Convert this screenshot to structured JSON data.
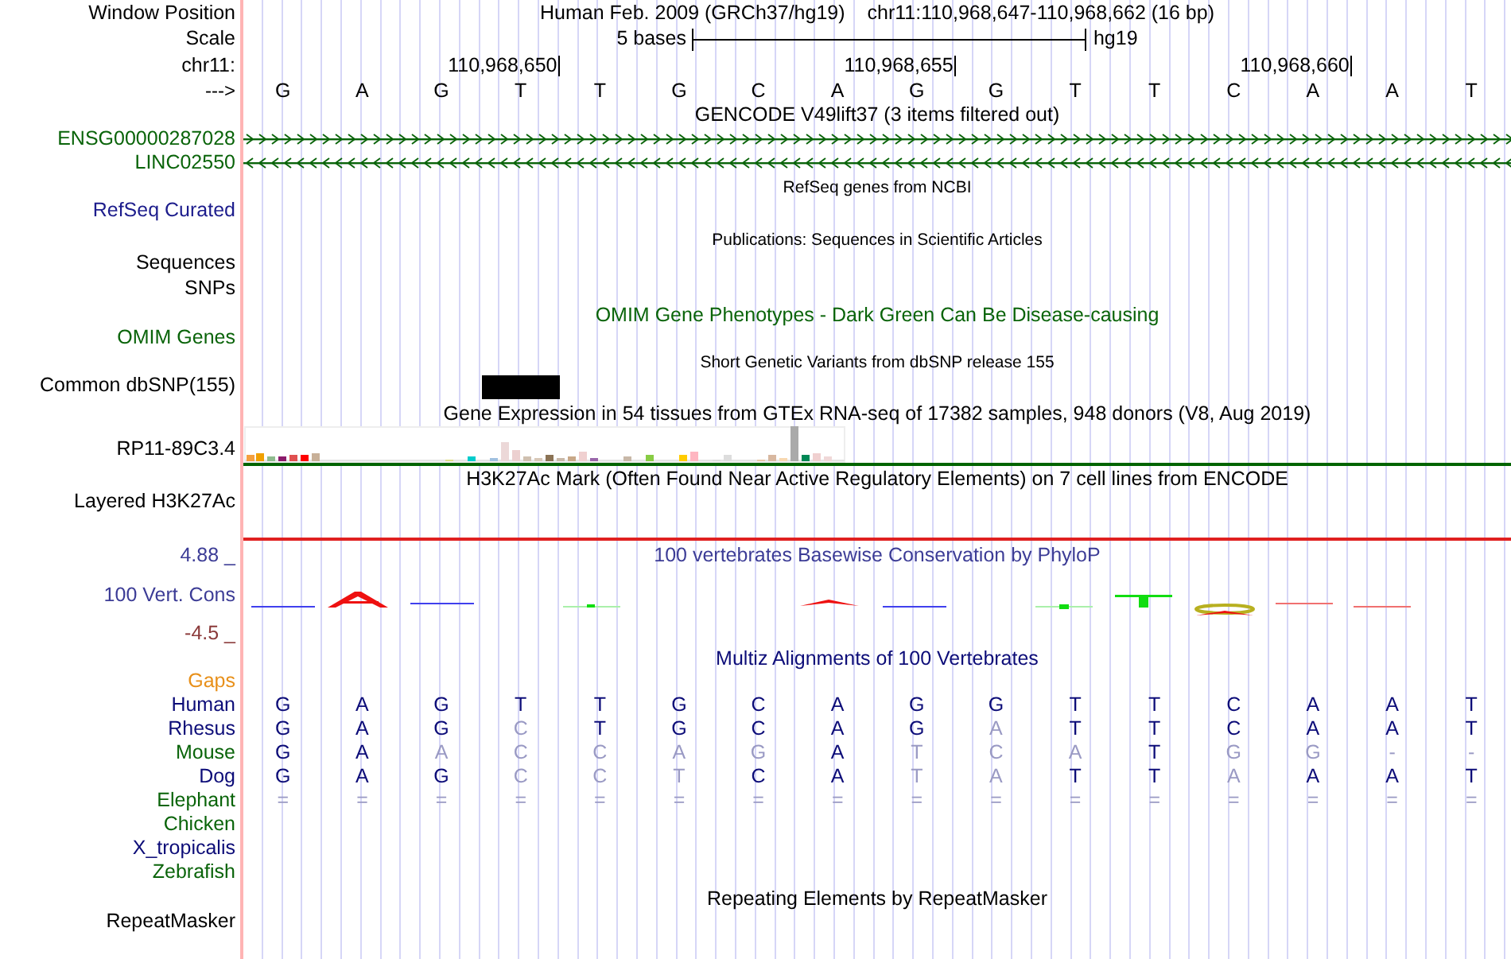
{
  "header": {
    "label": "Window Position",
    "assembly": "Human Feb. 2009 (GRCh37/hg19)",
    "position": "chr11:110,968,647-110,968,662 (16 bp)"
  },
  "scale": {
    "label": "Scale",
    "length": "5 bases",
    "assembly": "hg19"
  },
  "ruler": {
    "label": "chr11:"
  },
  "sequence": {
    "label": "--->",
    "bases": [
      {
        "base": "G"
      },
      {
        "base": "A"
      },
      {
        "base": "G"
      },
      {
        "base": "T",
        "tick": "110,968,650"
      },
      {
        "base": "T"
      },
      {
        "base": "G"
      },
      {
        "base": "C"
      },
      {
        "base": "A"
      },
      {
        "base": "G",
        "tick": "110,968,655"
      },
      {
        "base": "G"
      },
      {
        "base": "T"
      },
      {
        "base": "T"
      },
      {
        "base": "C"
      },
      {
        "base": "A",
        "tick": "110,968,660"
      },
      {
        "base": "A"
      },
      {
        "base": "T"
      }
    ]
  },
  "tracks": [
    {
      "kind": "genes",
      "title": "GENCODE V49lift37 (3 items filtered out)",
      "color": "#000000",
      "genes": [
        {
          "name": "ENSG00000287028",
          "kind": "forward",
          "color": "#0a640a"
        },
        {
          "name": "LINC02550",
          "kind": "reverse",
          "color": "#0a640a"
        }
      ]
    },
    {
      "kind": "note",
      "title": "RefSeq genes from NCBI",
      "color": "#000000",
      "labels": [
        {
          "text": "RefSeq Curated",
          "color": "#1c1c8c"
        }
      ]
    },
    {
      "kind": "note",
      "title": "Publications: Sequences in Scientific Articles",
      "color": "#000000",
      "labels": [
        {
          "text": "Sequences",
          "color": "#000000"
        },
        {
          "text": "SNPs",
          "color": "#000000"
        }
      ]
    },
    {
      "kind": "text",
      "title": "OMIM Gene Phenotypes - Dark Green Can Be Disease-causing",
      "color": "#0a640a",
      "labels": [
        {
          "text": "OMIM Genes",
          "color": "#0a640a"
        }
      ]
    },
    {
      "kind": "snp",
      "title": "Short Genetic Variants from dbSNP release 155",
      "color": "#000000",
      "labels": [
        {
          "text": "Common dbSNP(155)",
          "color": "#000000"
        }
      ]
    },
    {
      "kind": "expression",
      "title": "Gene Expression in 54 tissues from GTEx RNA-seq of 17382 samples, 948 donors (V8, Aug 2019)",
      "color": "#000000",
      "labels": [
        {
          "text": "RP11-89C3.4",
          "color": "#000000"
        }
      ]
    },
    {
      "kind": "h3k27ac",
      "title": "H3K27Ac Mark (Often Found Near Active Regulatory Elements) on 7 cell lines from ENCODE",
      "color": "#000000",
      "labels": [
        {
          "text": "Layered H3K27Ac",
          "color": "#000000"
        }
      ]
    },
    {
      "kind": "phylop",
      "title": "100 vertebrates Basewise Conservation by PhyloP",
      "color": "#3c3c96",
      "labels": [
        {
          "text": "4.88 _",
          "color": "#3c3c96"
        },
        {
          "text": "100 Vert. Cons",
          "color": "#3c3c96"
        },
        {
          "text": "-4.5 _",
          "color": "#8b3a3a"
        }
      ]
    },
    {
      "kind": "multiz",
      "title": "Multiz Alignments of 100 Vertebrates",
      "color": "#0c0c78",
      "gaps": {
        "text": "Gaps",
        "color": "#e8901a"
      },
      "species": [
        {
          "name": "Human",
          "color": "#0c0c78",
          "bases": [
            {
              "text": "G",
              "faded": false
            },
            {
              "text": "A",
              "faded": false
            },
            {
              "text": "G",
              "faded": false
            },
            {
              "text": "T",
              "faded": false
            },
            {
              "text": "T",
              "faded": false
            },
            {
              "text": "G",
              "faded": false
            },
            {
              "text": "C",
              "faded": false
            },
            {
              "text": "A",
              "faded": false
            },
            {
              "text": "G",
              "faded": false
            },
            {
              "text": "G",
              "faded": false
            },
            {
              "text": "T",
              "faded": false
            },
            {
              "text": "T",
              "faded": false
            },
            {
              "text": "C",
              "faded": false
            },
            {
              "text": "A",
              "faded": false
            },
            {
              "text": "A",
              "faded": false
            },
            {
              "text": "T",
              "faded": false
            }
          ]
        },
        {
          "name": "Rhesus",
          "color": "#0c0c78",
          "bases": [
            {
              "text": "G",
              "faded": false
            },
            {
              "text": "A",
              "faded": false
            },
            {
              "text": "G",
              "faded": false
            },
            {
              "text": "C",
              "faded": true
            },
            {
              "text": "T",
              "faded": false
            },
            {
              "text": "G",
              "faded": false
            },
            {
              "text": "C",
              "faded": false
            },
            {
              "text": "A",
              "faded": false
            },
            {
              "text": "G",
              "faded": false
            },
            {
              "text": "A",
              "faded": true
            },
            {
              "text": "T",
              "faded": false
            },
            {
              "text": "T",
              "faded": false
            },
            {
              "text": "C",
              "faded": false
            },
            {
              "text": "A",
              "faded": false
            },
            {
              "text": "A",
              "faded": false
            },
            {
              "text": "T",
              "faded": false
            }
          ]
        },
        {
          "name": "Mouse",
          "color": "#0a640a",
          "bases": [
            {
              "text": "G",
              "faded": false
            },
            {
              "text": "A",
              "faded": false
            },
            {
              "text": "A",
              "faded": true
            },
            {
              "text": "C",
              "faded": true
            },
            {
              "text": "C",
              "faded": true
            },
            {
              "text": "A",
              "faded": true
            },
            {
              "text": "G",
              "faded": true
            },
            {
              "text": "A",
              "faded": false
            },
            {
              "text": "T",
              "faded": true
            },
            {
              "text": "C",
              "faded": true
            },
            {
              "text": "A",
              "faded": true
            },
            {
              "text": "T",
              "faded": false
            },
            {
              "text": "G",
              "faded": true
            },
            {
              "text": "G",
              "faded": true
            },
            {
              "text": "-",
              "faded": true
            },
            {
              "text": "-",
              "faded": true
            }
          ]
        },
        {
          "name": "Dog",
          "color": "#0c0c78",
          "bases": [
            {
              "text": "G",
              "faded": false
            },
            {
              "text": "A",
              "faded": false
            },
            {
              "text": "G",
              "faded": false
            },
            {
              "text": "C",
              "faded": true
            },
            {
              "text": "C",
              "faded": true
            },
            {
              "text": "T",
              "faded": true
            },
            {
              "text": "C",
              "faded": false
            },
            {
              "text": "A",
              "faded": false
            },
            {
              "text": "T",
              "faded": true
            },
            {
              "text": "A",
              "faded": true
            },
            {
              "text": "T",
              "faded": false
            },
            {
              "text": "T",
              "faded": false
            },
            {
              "text": "A",
              "faded": true
            },
            {
              "text": "A",
              "faded": false
            },
            {
              "text": "A",
              "faded": false
            },
            {
              "text": "T",
              "faded": false
            }
          ]
        },
        {
          "name": "Elephant",
          "color": "#0a640a",
          "bases": [
            {
              "text": "=",
              "faded": true
            },
            {
              "text": "=",
              "faded": true
            },
            {
              "text": "=",
              "faded": true
            },
            {
              "text": "=",
              "faded": true
            },
            {
              "text": "=",
              "faded": true
            },
            {
              "text": "=",
              "faded": true
            },
            {
              "text": "=",
              "faded": true
            },
            {
              "text": "=",
              "faded": true
            },
            {
              "text": "=",
              "faded": true
            },
            {
              "text": "=",
              "faded": true
            },
            {
              "text": "=",
              "faded": true
            },
            {
              "text": "=",
              "faded": true
            },
            {
              "text": "=",
              "faded": true
            },
            {
              "text": "=",
              "faded": true
            },
            {
              "text": "=",
              "faded": true
            },
            {
              "text": "=",
              "faded": true
            }
          ]
        },
        {
          "name": "Chicken",
          "color": "#0a640a"
        },
        {
          "name": "X_tropicalis",
          "color": "#0c0c78"
        },
        {
          "name": "Zebrafish",
          "color": "#0a640a"
        }
      ]
    },
    {
      "kind": "note-large",
      "title": "Repeating Elements by RepeatMasker",
      "color": "#000000",
      "labels": [
        {
          "text": "RepeatMasker",
          "color": "#000000"
        }
      ]
    }
  ]
}
